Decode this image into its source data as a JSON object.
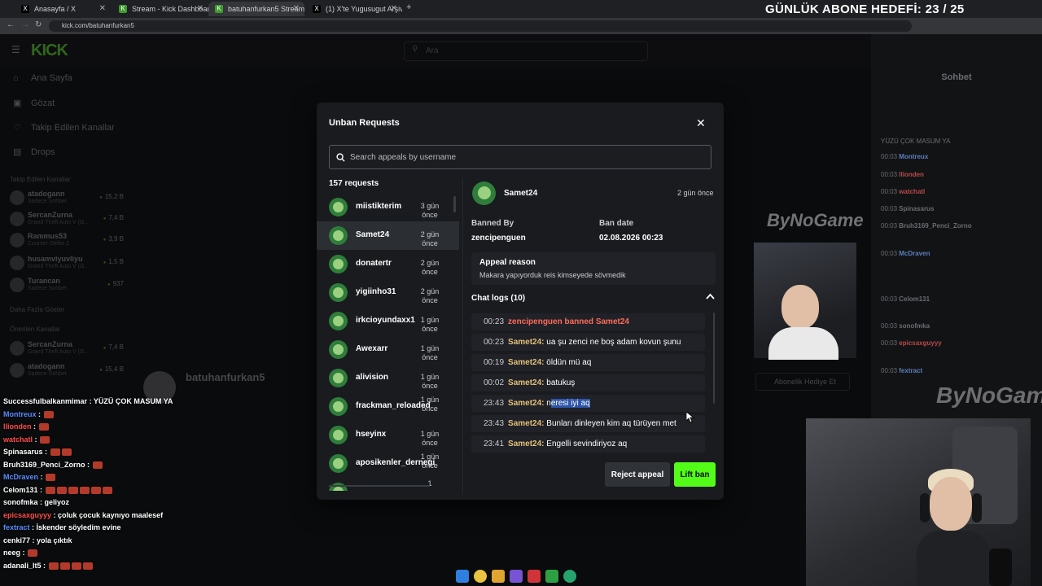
{
  "browser": {
    "tabs": [
      {
        "label": "Anasayfa / X"
      },
      {
        "label": "Stream - Kick Dashboard"
      },
      {
        "label": "batuhanfurkan5 Stream - Watc"
      },
      {
        "label": "(1) X'te Yugusugut Arşivi \"batuh"
      }
    ],
    "url": "kick.com/batuhanfurkan5"
  },
  "overlay_banner": "GÜNLÜK ABONE HEDEFİ: 23 / 25",
  "kick": {
    "logo": "KICK",
    "search_placeholder": "Ara",
    "nav": [
      {
        "label": "Ana Sayfa",
        "icon": "home-icon"
      },
      {
        "label": "Gözat",
        "icon": "browse-icon"
      },
      {
        "label": "Takip Edilen Kanallar",
        "icon": "heart-icon"
      },
      {
        "label": "Drops",
        "icon": "drops-icon"
      }
    ],
    "followed_heading": "Takip Edilen Kanallar",
    "followed": [
      {
        "name": "atadogann",
        "sub": "Sadece Sohbet",
        "viewers": "15,2 B"
      },
      {
        "name": "SercanZurna",
        "sub": "Grand Theft Auto V (G...",
        "viewers": "7,4 B"
      },
      {
        "name": "Rammus53",
        "sub": "Counter-Strike 2",
        "viewers": "3,9 B"
      },
      {
        "name": "husamviyuvliyu",
        "sub": "Grand Theft Auto V (G...",
        "viewers": "1,5 B"
      },
      {
        "name": "Turancan",
        "sub": "Sadece Sohbet",
        "viewers": "937"
      }
    ],
    "show_more": "Daha Fazla Göster",
    "recommended_heading": "Önerilen Kanallar",
    "recommended": [
      {
        "name": "SercanZurna",
        "sub": "Grand Theft Auto V (G...",
        "viewers": "7,4 B"
      },
      {
        "name": "atadogann",
        "sub": "Sadece Sohbet",
        "viewers": "15,4 B"
      }
    ],
    "chat_title": "Sohbet",
    "channel_name": "batuhanfurkan5",
    "subscribe_gift": "Abonelik Hediye Et"
  },
  "stream_chat": [
    {
      "user": "Successfulbalkanmimar",
      "msg": "YÜZÜ ÇOK MASUM YA",
      "color": "#ffffff",
      "emotes": 0
    },
    {
      "user": "Montreux",
      "msg": "",
      "color": "#5b8cff",
      "emotes": 1
    },
    {
      "user": "llionden",
      "msg": "",
      "color": "#ff4d4d",
      "emotes": 1
    },
    {
      "user": "watchatl",
      "msg": "",
      "color": "#ff4d4d",
      "emotes": 1
    },
    {
      "user": "Spinasarus",
      "msg": "",
      "color": "#ffffff",
      "emotes": 2
    },
    {
      "user": "Bruh3169_Penci_Zorno",
      "msg": "",
      "color": "#ffffff",
      "emotes": 1
    },
    {
      "user": "McDraven",
      "msg": "",
      "color": "#5b8cff",
      "emotes": 1
    },
    {
      "user": "Celom131",
      "msg": "",
      "color": "#ffffff",
      "emotes": 6
    },
    {
      "user": "sonofmka",
      "msg": "geliyoz",
      "color": "#ffffff",
      "emotes": 0
    },
    {
      "user": "epicsaxguyyy",
      "msg": "çoluk çocuk kaynıyo maalesef",
      "color": "#ff4d4d",
      "emotes": 0
    },
    {
      "user": "fextract",
      "msg": "İskender söyledim evine",
      "color": "#5b8cff",
      "emotes": 0
    },
    {
      "user": "cenki77",
      "msg": "yola çıktık",
      "color": "#ffffff",
      "emotes": 0
    },
    {
      "user": "neeg",
      "msg": "",
      "color": "#ffffff",
      "emotes": 1
    },
    {
      "user": "adanali_lt5",
      "msg": "",
      "color": "#ffffff",
      "emotes": 4
    }
  ],
  "side_chat": [
    {
      "time": "00:03",
      "user": "Montreux"
    },
    {
      "time": "00:03",
      "user": "llionden"
    },
    {
      "time": "00:03",
      "user": "watchatl"
    },
    {
      "time": "00:03",
      "user": "Spinasarus"
    },
    {
      "time": "00:03",
      "user": "Bruh3169_Penci_Zorno"
    },
    {
      "time": "00:03",
      "user": "McDraven"
    },
    {
      "time": "00:03",
      "user": "Celom131"
    },
    {
      "time": "00:03",
      "user": "sonofmka"
    },
    {
      "time": "00:03",
      "user": "epicsaxguyyy"
    },
    {
      "time": "00:03",
      "user": "fextract"
    }
  ],
  "side_chat_top": "YÜZÜ ÇOK MASUM YA",
  "watermark": "ByNoGame",
  "modal": {
    "title": "Unban Requests",
    "search_placeholder": "Search appeals by username",
    "request_count": "157 requests",
    "requests": [
      {
        "name": "miistikterim",
        "time": "3 gün önce"
      },
      {
        "name": "Samet24",
        "time": "2 gün önce",
        "selected": true
      },
      {
        "name": "donatertr",
        "time": "2 gün önce"
      },
      {
        "name": "yigiinho31",
        "time": "2 gün önce"
      },
      {
        "name": "irkcioyundaxx1",
        "time": "1 gün önce"
      },
      {
        "name": "Awexarr",
        "time": "1 gün önce"
      },
      {
        "name": "alivision",
        "time": "1 gün önce"
      },
      {
        "name": "frackman_reloaded",
        "time": "1 gün önce"
      },
      {
        "name": "hseyinx",
        "time": "1 gün önce"
      },
      {
        "name": "aposikenler_dernegi",
        "time": "1 gün önce"
      },
      {
        "name": "",
        "time": "1"
      }
    ],
    "detail": {
      "username": "Samet24",
      "time": "2 gün önce",
      "banned_by_label": "Banned By",
      "banned_by": "zencipenguen",
      "ban_date_label": "Ban date",
      "ban_date": "02.08.2026 00:23",
      "appeal_reason_label": "Appeal reason",
      "appeal_reason": "Makara yapıyorduk reis kimseyede sövmedik",
      "chat_logs_label": "Chat logs (10)",
      "chat_logs": [
        {
          "time": "00:23",
          "user": "zencipenguen banned Samet24",
          "msg": "",
          "type": "ban"
        },
        {
          "time": "00:23",
          "user": "Samet24:",
          "msg": "ua şu zenci ne boş adam kovun şunu",
          "type": "msg"
        },
        {
          "time": "00:19",
          "user": "Samet24:",
          "msg": "öldün mü aq",
          "type": "msg"
        },
        {
          "time": "00:02",
          "user": "Samet24:",
          "msg": "batukuş",
          "type": "msg"
        },
        {
          "time": "23:43",
          "user": "Samet24:",
          "msg": "n",
          "highlight": "eresi iyi aq",
          "type": "msg"
        },
        {
          "time": "23:43",
          "user": "Samet24:",
          "msg": "Bunları dinleyen kim aq türüyen met",
          "type": "msg"
        },
        {
          "time": "23:41",
          "user": "Samet24:",
          "msg": "Engelli sevindiriyoz aq",
          "type": "msg"
        }
      ]
    },
    "reject_label": "Reject appeal",
    "lift_label": "Lift ban"
  },
  "colors": {
    "kick_green": "#53fc18",
    "ban_red": "#ff6b5a",
    "username_gold": "#e3c07a"
  }
}
